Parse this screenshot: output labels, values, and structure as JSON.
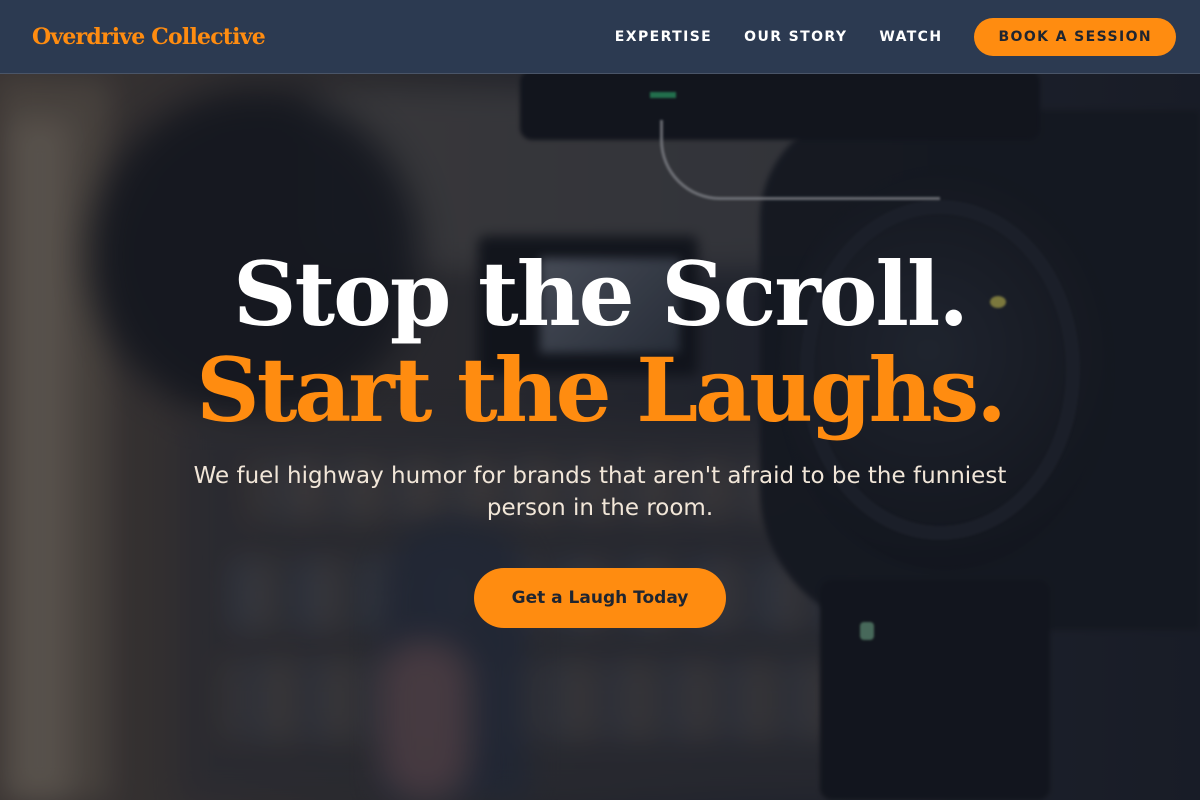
{
  "header": {
    "logo": "Overdrive Collective",
    "nav": [
      {
        "label": "EXPERTISE"
      },
      {
        "label": "OUR STORY"
      },
      {
        "label": "WATCH"
      }
    ],
    "cta_label": "BOOK A SESSION"
  },
  "hero": {
    "headline_line1": "Stop the Scroll.",
    "headline_line2": "Start the Laughs.",
    "subtitle": "We fuel highway humor for brands that aren't afraid to be the funniest person in the room.",
    "cta_label": "Get a Laugh Today",
    "background_image": "camera-studio-photo"
  },
  "colors": {
    "accent": "#ff8c10",
    "header_bg": "#2c3a51",
    "text_light": "#ffffff",
    "subtitle_text": "#f1e6d8"
  }
}
